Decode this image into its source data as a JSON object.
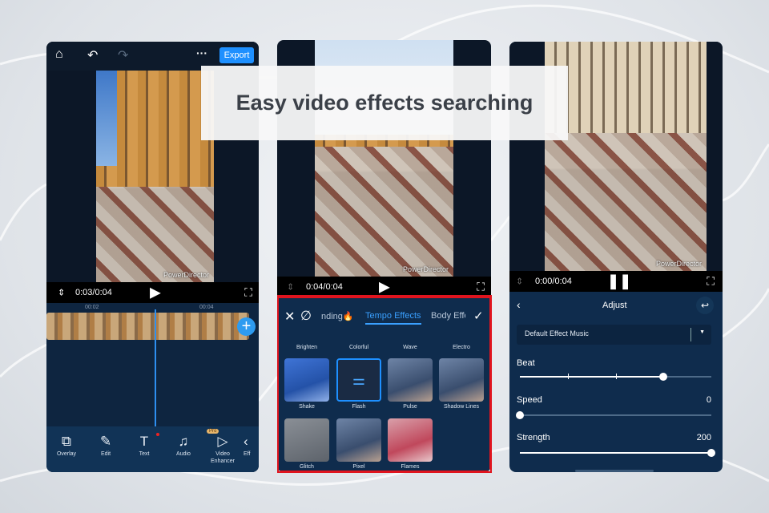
{
  "banner": {
    "title": "Easy video effects searching"
  },
  "colors": {
    "accent": "#1e90ff",
    "highlight_border": "#e0141e",
    "panel_bg": "#0f2c4d"
  },
  "panel_editor": {
    "export_label": "Export",
    "watermark": "PowerDirector",
    "time": "0:03/0:04",
    "ruler": [
      "00:02",
      "00:04"
    ],
    "toolbar": [
      {
        "label": "Overlay",
        "icon": "overlay-icon"
      },
      {
        "label": "Edit",
        "icon": "edit-icon"
      },
      {
        "label": "Text",
        "icon": "text-icon"
      },
      {
        "label": "Audio",
        "icon": "audio-icon"
      },
      {
        "label": "Video Enhancer",
        "icon": "video-enhancer-icon",
        "badge": "Pro"
      },
      {
        "label": "Eff",
        "icon": "effects-icon"
      }
    ]
  },
  "panel_effects": {
    "watermark": "PowerDirector",
    "time": "0:04/0:04",
    "tabs": [
      "nding🔥",
      "Tempo Effects",
      "Body Effe"
    ],
    "active_tab": "Tempo Effects",
    "row_top": [
      "Brighten",
      "Colorful",
      "Wave",
      "Electro"
    ],
    "effects": [
      {
        "label": "Shake",
        "selected": false
      },
      {
        "label": "Flash",
        "selected": true
      },
      {
        "label": "Pulse",
        "pro": true
      },
      {
        "label": "Shadow Lines",
        "pro": true
      },
      {
        "label": "Glitch"
      },
      {
        "label": "Pixel"
      },
      {
        "label": "Flames"
      }
    ]
  },
  "panel_adjust": {
    "watermark": "PowerDirector",
    "time": "0:00/0:04",
    "title": "Adjust",
    "music_select": "Default Effect Music",
    "sliders": [
      {
        "label": "Beat",
        "value": "",
        "fraction": 0.75
      },
      {
        "label": "Speed",
        "value": "0",
        "fraction": 0
      },
      {
        "label": "Strength",
        "value": "200",
        "fraction": 1
      }
    ]
  }
}
